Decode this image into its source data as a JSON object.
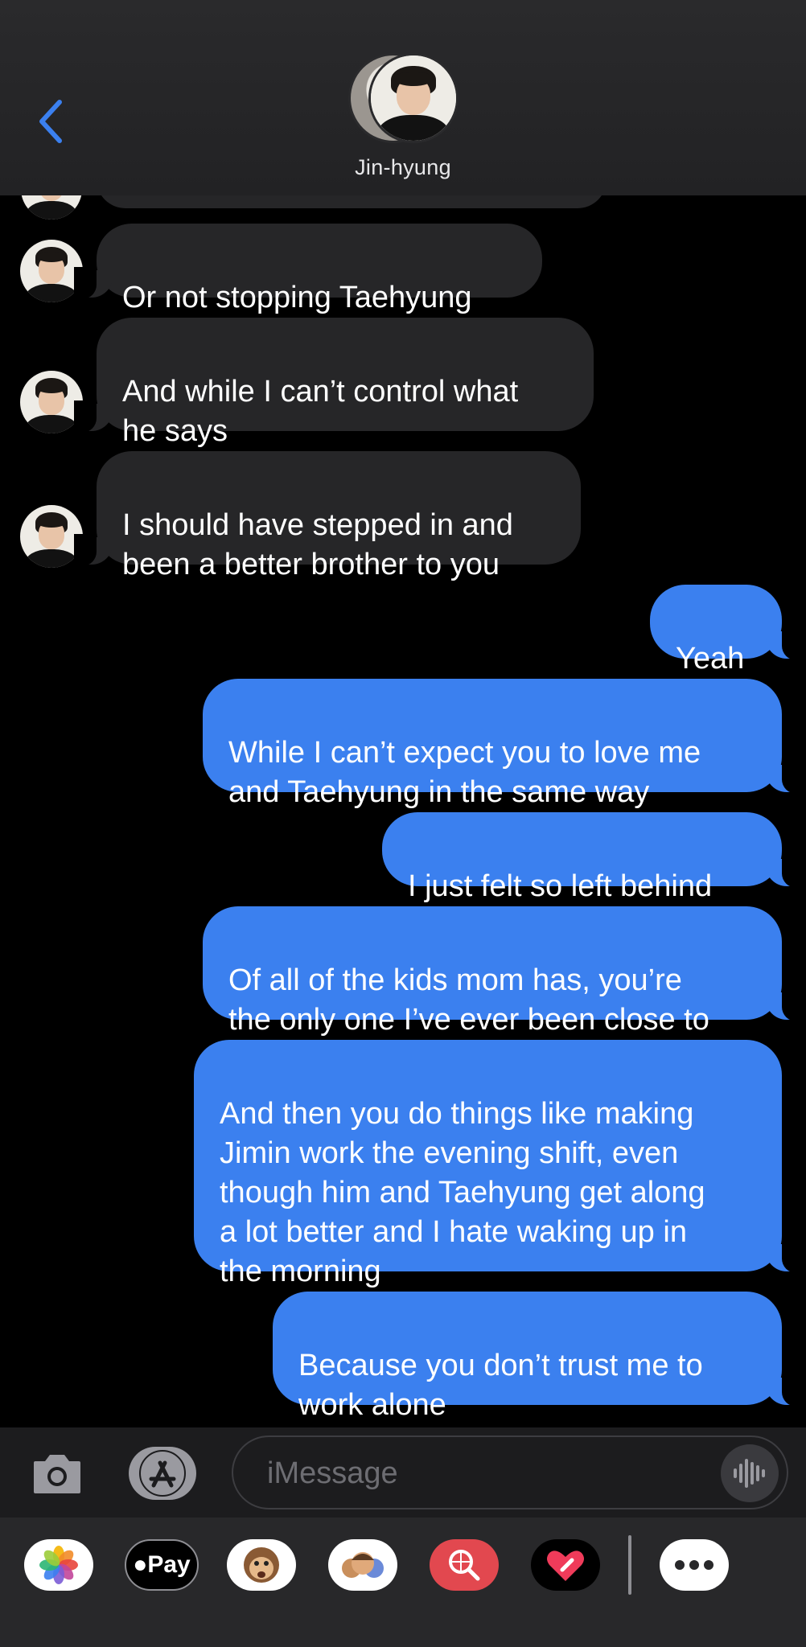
{
  "header": {
    "contact_name": "Jin-hyung",
    "back_icon": "chevron-left-icon",
    "accent_color": "#3b80ef"
  },
  "messages": [
    {
      "direction": "incoming",
      "text": "Or not stopping Taehyung"
    },
    {
      "direction": "incoming",
      "text": "And while I can’t control what\nhe says"
    },
    {
      "direction": "incoming",
      "text": "I should have stepped in and\nbeen a better brother to you"
    },
    {
      "direction": "outgoing",
      "text": "Yeah"
    },
    {
      "direction": "outgoing",
      "text": "While I can’t expect you to love me\nand Taehyung in the same way"
    },
    {
      "direction": "outgoing",
      "text": "I just felt so left behind"
    },
    {
      "direction": "outgoing",
      "text": "Of all of the kids mom has, you’re\nthe only one I’ve ever been close to"
    },
    {
      "direction": "outgoing",
      "text": "And then you do things like making\nJimin work the evening shift, even\nthough him and Taehyung get along\na lot better and I hate waking up in\nthe morning"
    },
    {
      "direction": "outgoing",
      "text": "Because you don’t trust me to\nwork alone"
    }
  ],
  "input_bar": {
    "placeholder": "iMessage",
    "camera_icon": "camera-icon",
    "apps_icon": "app-store-icon",
    "audio_icon": "audio-waveform-icon"
  },
  "app_drawer": {
    "items": [
      {
        "name": "photos-icon"
      },
      {
        "name": "apple-pay-icon",
        "label": "Pay"
      },
      {
        "name": "animoji-icon"
      },
      {
        "name": "memoji-icon"
      },
      {
        "name": "image-search-icon"
      },
      {
        "name": "digital-touch-icon"
      },
      {
        "name": "more-icon"
      }
    ]
  }
}
